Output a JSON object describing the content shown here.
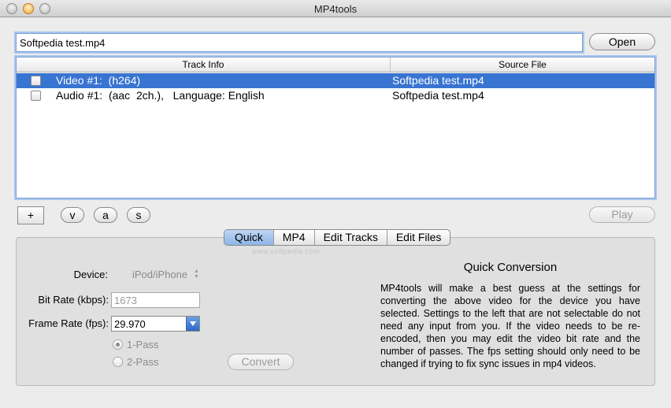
{
  "window": {
    "title": "MP4tools"
  },
  "file": {
    "path": "Softpedia test.mp4",
    "open_label": "Open"
  },
  "tracks": {
    "headers": [
      "Track Info",
      "Source File"
    ],
    "rows": [
      {
        "info": "Video #1:  (h264)",
        "source": "Softpedia test.mp4",
        "checked": false,
        "selected": true
      },
      {
        "info": "Audio #1:  (aac  2ch.),   Language: English",
        "source": "Softpedia test.mp4",
        "checked": false,
        "selected": false
      }
    ]
  },
  "toolbar": {
    "add_label": "+",
    "v_label": "v",
    "a_label": "a",
    "s_label": "s",
    "play_label": "Play"
  },
  "tabs": [
    {
      "label": "Quick",
      "active": true
    },
    {
      "label": "MP4",
      "active": false
    },
    {
      "label": "Edit Tracks",
      "active": false
    },
    {
      "label": "Edit Files",
      "active": false
    }
  ],
  "watermark": "www.softpedia.com",
  "quick": {
    "device_label": "Device:",
    "device_value": "iPod/iPhone",
    "bitrate_label": "Bit Rate (kbps):",
    "bitrate_value": "1673",
    "framerate_label": "Frame Rate (fps):",
    "framerate_value": "29.970",
    "pass1_label": "1-Pass",
    "pass2_label": "2-Pass",
    "pass_selected": "1-Pass",
    "convert_label": "Convert",
    "info_title": "Quick Conversion",
    "info_body": "MP4tools will make a best guess at the settings for converting the above video for the device you have selected.  Settings to the left that are not selectable do not need any input from you.  If the video needs to be re-encoded, then you may edit the video bit rate and the number of passes. The fps setting should only need to be changed if trying to fix sync issues in mp4 videos."
  },
  "colors": {
    "selection": "#3874d1",
    "focus_ring": "#a9c6ef"
  }
}
